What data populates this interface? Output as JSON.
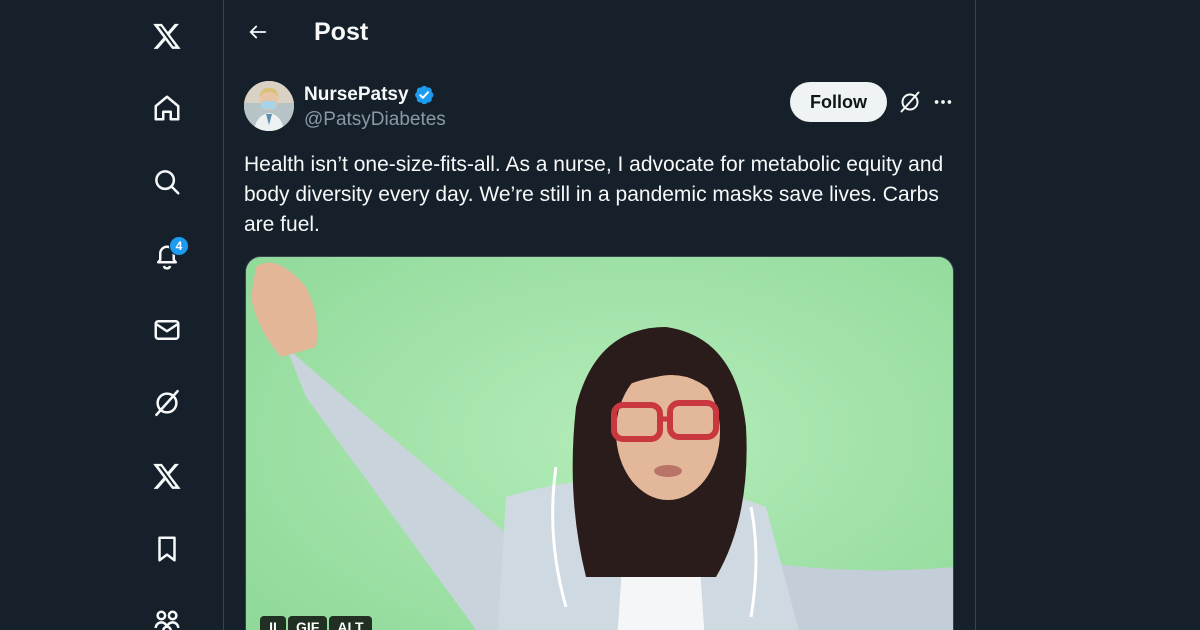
{
  "nav": {
    "items": [
      {
        "name": "x-logo",
        "icon": "x-logo-icon"
      },
      {
        "name": "home",
        "icon": "home-icon"
      },
      {
        "name": "explore",
        "icon": "search-icon"
      },
      {
        "name": "notifications",
        "icon": "bell-icon",
        "badge": "4"
      },
      {
        "name": "messages",
        "icon": "envelope-icon"
      },
      {
        "name": "grok",
        "icon": "grok-icon"
      },
      {
        "name": "premium",
        "icon": "x-icon"
      },
      {
        "name": "bookmarks",
        "icon": "bookmark-icon"
      },
      {
        "name": "communities",
        "icon": "people-icon"
      }
    ]
  },
  "header": {
    "title": "Post"
  },
  "post": {
    "author_name": "NursePatsy",
    "author_handle": "@PatsyDiabetes",
    "follow_label": "Follow",
    "text": "Health isn’t one-size-fits-all. As a nurse, I advocate for metabolic equity and body diversity every day. We’re still in a pandemic masks save lives. Carbs are fuel.",
    "media": {
      "badges": [
        "II",
        "GIF",
        "ALT"
      ]
    }
  },
  "colors": {
    "background": "#15202b",
    "border": "#38444d",
    "accent": "#1d9bf0",
    "text_primary": "#f7f9f9",
    "text_secondary": "#8b98a5"
  }
}
